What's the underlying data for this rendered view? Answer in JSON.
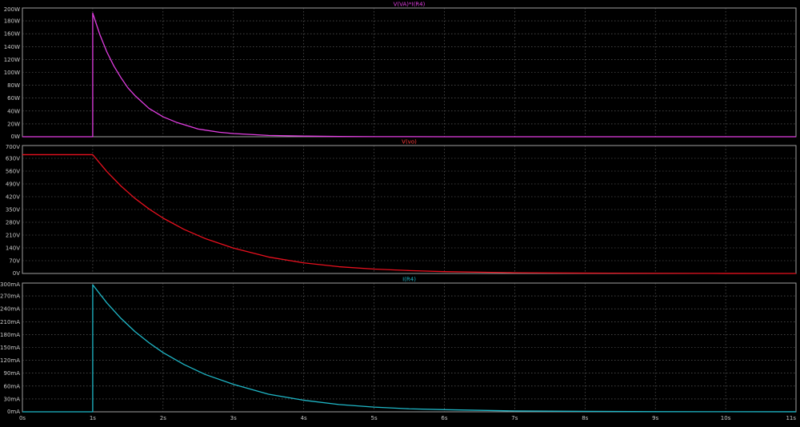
{
  "app": {
    "background": "#000000",
    "grid_color": "#6e6e6e",
    "frame_color": "#a0a0a0",
    "label_color": "#c8c8c8"
  },
  "chart_data": [
    {
      "type": "line",
      "title": "V(VA)*I(R4)",
      "title_color": "#e23ee2",
      "xlim": [
        0,
        11
      ],
      "ylim": [
        0,
        200
      ],
      "y_ticks": [
        0,
        20,
        40,
        60,
        80,
        100,
        120,
        140,
        160,
        180,
        200
      ],
      "y_tick_labels": [
        "0W",
        "20W",
        "40W",
        "60W",
        "80W",
        "100W",
        "120W",
        "140W",
        "160W",
        "180W",
        "200W"
      ],
      "grid": true,
      "series": [
        {
          "name": "V(VA)*I(R4)",
          "color": "#e23ee2",
          "x": [
            0,
            0.999,
            1.0,
            1.0,
            1.1,
            1.2,
            1.3,
            1.4,
            1.5,
            1.6,
            1.8,
            2.0,
            2.2,
            2.5,
            2.8,
            3.0,
            3.5,
            4.0,
            4.5,
            5.0,
            6.0,
            7.0,
            8.0,
            9.0,
            10.0,
            11.0
          ],
          "y": [
            0,
            0,
            0,
            192,
            159,
            132,
            110,
            92,
            76,
            64,
            44,
            31,
            22,
            12,
            7,
            5,
            2,
            1,
            0.4,
            0.2,
            0.02,
            0,
            0,
            0,
            0,
            0
          ]
        }
      ]
    },
    {
      "type": "line",
      "title": "V(vo)",
      "title_color": "#ff3b3b",
      "xlim": [
        0,
        11
      ],
      "ylim": [
        0,
        700
      ],
      "y_ticks": [
        0,
        70,
        140,
        210,
        280,
        350,
        420,
        490,
        560,
        630,
        700
      ],
      "y_tick_labels": [
        "0V",
        "70V",
        "140V",
        "210V",
        "280V",
        "350V",
        "420V",
        "490V",
        "560V",
        "630V",
        "700V"
      ],
      "grid": true,
      "series": [
        {
          "name": "V(vo)",
          "color": "#e8101e",
          "x": [
            0,
            0.5,
            1.0,
            1.2,
            1.4,
            1.6,
            1.8,
            2.0,
            2.3,
            2.6,
            3.0,
            3.5,
            4.0,
            4.5,
            5.0,
            5.5,
            6.0,
            7.0,
            8.0,
            9.0,
            10.0,
            11.0
          ],
          "y": [
            650,
            650,
            650,
            558,
            479,
            411,
            353,
            303,
            241,
            191,
            139,
            90,
            58,
            37,
            24,
            16,
            10,
            4,
            2,
            1,
            0.3,
            0.1
          ]
        }
      ]
    },
    {
      "type": "line",
      "title": "I(R4)",
      "title_color": "#1fb8c8",
      "xlim": [
        0,
        11
      ],
      "ylim": [
        0,
        300
      ],
      "y_ticks": [
        0,
        30,
        60,
        90,
        120,
        150,
        180,
        210,
        240,
        270,
        300
      ],
      "y_tick_labels": [
        "0mA",
        "30mA",
        "60mA",
        "90mA",
        "120mA",
        "150mA",
        "180mA",
        "210mA",
        "240mA",
        "270mA",
        "300mA"
      ],
      "x_ticks": [
        0,
        1,
        2,
        3,
        4,
        5,
        6,
        7,
        8,
        9,
        10,
        11
      ],
      "x_tick_labels": [
        "0s",
        "1s",
        "2s",
        "3s",
        "4s",
        "5s",
        "6s",
        "7s",
        "8s",
        "9s",
        "10s",
        "11s"
      ],
      "grid": true,
      "series": [
        {
          "name": "I(R4)",
          "color": "#1fb8c8",
          "x": [
            0,
            0.999,
            1.0,
            1.0,
            1.2,
            1.4,
            1.6,
            1.8,
            2.0,
            2.3,
            2.6,
            3.0,
            3.5,
            4.0,
            4.5,
            5.0,
            5.5,
            6.0,
            7.0,
            8.0,
            9.0,
            10.0,
            11.0
          ],
          "y": [
            0,
            0,
            0,
            296,
            254,
            218,
            187,
            161,
            138,
            110,
            87,
            64,
            41,
            27,
            17,
            11,
            7,
            5,
            2,
            1,
            0.4,
            0.2,
            0.1
          ]
        }
      ]
    }
  ]
}
